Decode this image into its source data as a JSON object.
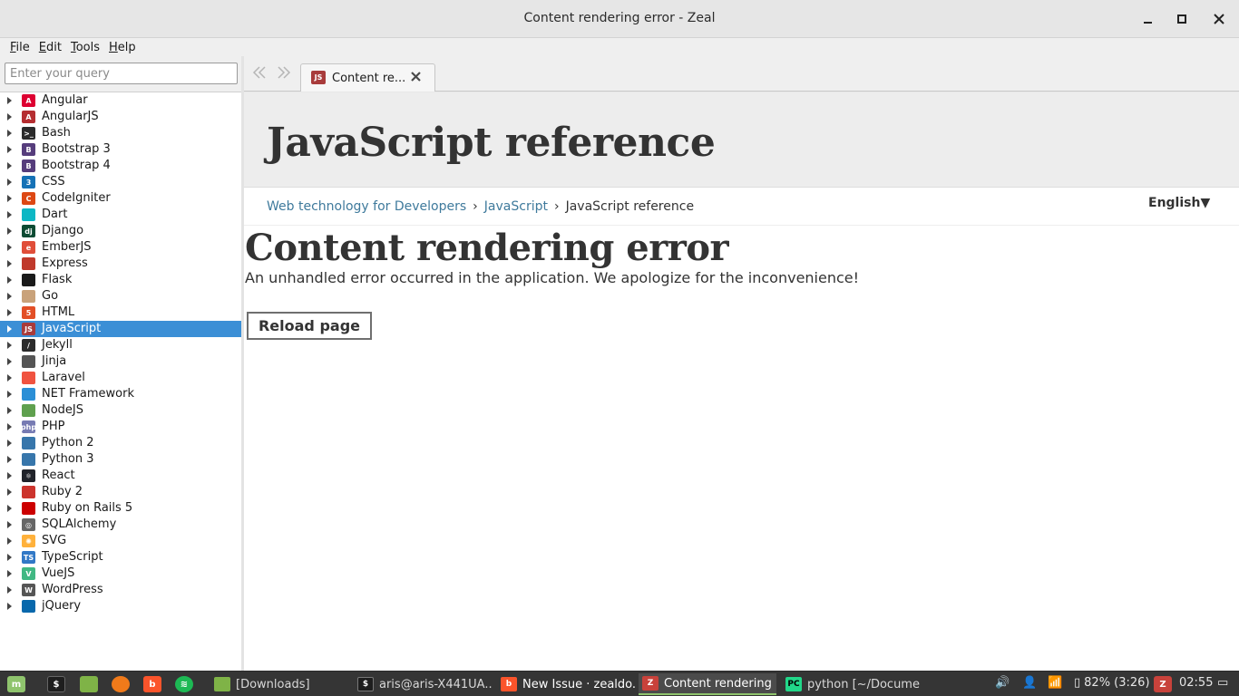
{
  "window": {
    "title": "Content rendering error - Zeal"
  },
  "menubar": [
    {
      "first": "F",
      "rest": "ile"
    },
    {
      "first": "E",
      "rest": "dit"
    },
    {
      "first": "T",
      "rest": "ools"
    },
    {
      "first": "H",
      "rest": "elp"
    }
  ],
  "search": {
    "placeholder": "Enter your query",
    "value": ""
  },
  "docsets": [
    {
      "label": "Angular",
      "icon": "angular-icon",
      "color": "#dd0031",
      "glyph": "A"
    },
    {
      "label": "AngularJS",
      "icon": "angularjs-icon",
      "color": "#b52e31",
      "glyph": "A"
    },
    {
      "label": "Bash",
      "icon": "bash-icon",
      "color": "#2b2b2b",
      "glyph": ">_"
    },
    {
      "label": "Bootstrap 3",
      "icon": "bootstrap-icon",
      "color": "#563d7c",
      "glyph": "B"
    },
    {
      "label": "Bootstrap 4",
      "icon": "bootstrap-icon",
      "color": "#563d7c",
      "glyph": "B"
    },
    {
      "label": "CSS",
      "icon": "css-icon",
      "color": "#1572b6",
      "glyph": "3"
    },
    {
      "label": "CodeIgniter",
      "icon": "codeigniter-icon",
      "color": "#dd4814",
      "glyph": "C"
    },
    {
      "label": "Dart",
      "icon": "dart-icon",
      "color": "#0db7c4",
      "glyph": ""
    },
    {
      "label": "Django",
      "icon": "django-icon",
      "color": "#0c4b33",
      "glyph": "dj"
    },
    {
      "label": "EmberJS",
      "icon": "ember-icon",
      "color": "#e04e39",
      "glyph": "e"
    },
    {
      "label": "Express",
      "icon": "express-icon",
      "color": "#c0392b",
      "glyph": ""
    },
    {
      "label": "Flask",
      "icon": "flask-icon",
      "color": "#1a1a1a",
      "glyph": ""
    },
    {
      "label": "Go",
      "icon": "go-gopher-icon",
      "color": "#c9a27a",
      "glyph": ""
    },
    {
      "label": "HTML",
      "icon": "html5-icon",
      "color": "#e34f26",
      "glyph": "5"
    },
    {
      "label": "JavaScript",
      "icon": "javascript-icon",
      "color": "#a83b3b",
      "glyph": "JS"
    },
    {
      "label": "Jekyll",
      "icon": "jekyll-icon",
      "color": "#2b2b2b",
      "glyph": "/"
    },
    {
      "label": "Jinja",
      "icon": "jinja-icon",
      "color": "#555555",
      "glyph": ""
    },
    {
      "label": "Laravel",
      "icon": "laravel-icon",
      "color": "#f05340",
      "glyph": ""
    },
    {
      "label": "NET Framework",
      "icon": "windows-icon",
      "color": "#2b8fd6",
      "glyph": ""
    },
    {
      "label": "NodeJS",
      "icon": "nodejs-icon",
      "color": "#5fa04e",
      "glyph": ""
    },
    {
      "label": "PHP",
      "icon": "php-icon",
      "color": "#777bb3",
      "glyph": "php"
    },
    {
      "label": "Python 2",
      "icon": "python-icon",
      "color": "#3776ab",
      "glyph": ""
    },
    {
      "label": "Python 3",
      "icon": "python-icon",
      "color": "#3776ab",
      "glyph": ""
    },
    {
      "label": "React",
      "icon": "react-icon",
      "color": "#20232a",
      "glyph": "⚛"
    },
    {
      "label": "Ruby 2",
      "icon": "ruby-icon",
      "color": "#cc342d",
      "glyph": ""
    },
    {
      "label": "Ruby on Rails 5",
      "icon": "rails-icon",
      "color": "#cc0000",
      "glyph": ""
    },
    {
      "label": "SQLAlchemy",
      "icon": "sqlalchemy-icon",
      "color": "#666666",
      "glyph": "◎"
    },
    {
      "label": "SVG",
      "icon": "svg-icon",
      "color": "#ffb13b",
      "glyph": "✺"
    },
    {
      "label": "TypeScript",
      "icon": "typescript-icon",
      "color": "#3178c6",
      "glyph": "TS"
    },
    {
      "label": "VueJS",
      "icon": "vue-icon",
      "color": "#41b883",
      "glyph": "V"
    },
    {
      "label": "WordPress",
      "icon": "wordpress-icon",
      "color": "#555555",
      "glyph": "W"
    },
    {
      "label": "jQuery",
      "icon": "jquery-icon",
      "color": "#0868ac",
      "glyph": ""
    }
  ],
  "selected_docset": "JavaScript",
  "tab": {
    "label": "Content re...",
    "icon_glyph": "JS"
  },
  "page": {
    "ref_title": "JavaScript reference",
    "breadcrumb": [
      "Web technology for Developers",
      "JavaScript",
      "JavaScript reference"
    ],
    "breadcrumb_sep": "›",
    "language": "English▼",
    "error_title": "Content rendering error",
    "error_message": "An unhandled error occurred in the application. We apologize for the inconvenience!",
    "reload_label": "Reload page"
  },
  "taskbar": {
    "windows": [
      {
        "label": "[Downloads]",
        "icon": "folder-icon"
      },
      {
        "label": "aris@aris-X441UA...",
        "icon": "terminal-icon"
      },
      {
        "label": "New Issue · zealdo...",
        "icon": "brave-icon"
      },
      {
        "label": "Content rendering ...",
        "icon": "zeal-icon"
      },
      {
        "label": "python [~/Docume...",
        "icon": "pycharm-icon"
      }
    ],
    "battery": "82% (3:26)",
    "clock": "02:55"
  }
}
